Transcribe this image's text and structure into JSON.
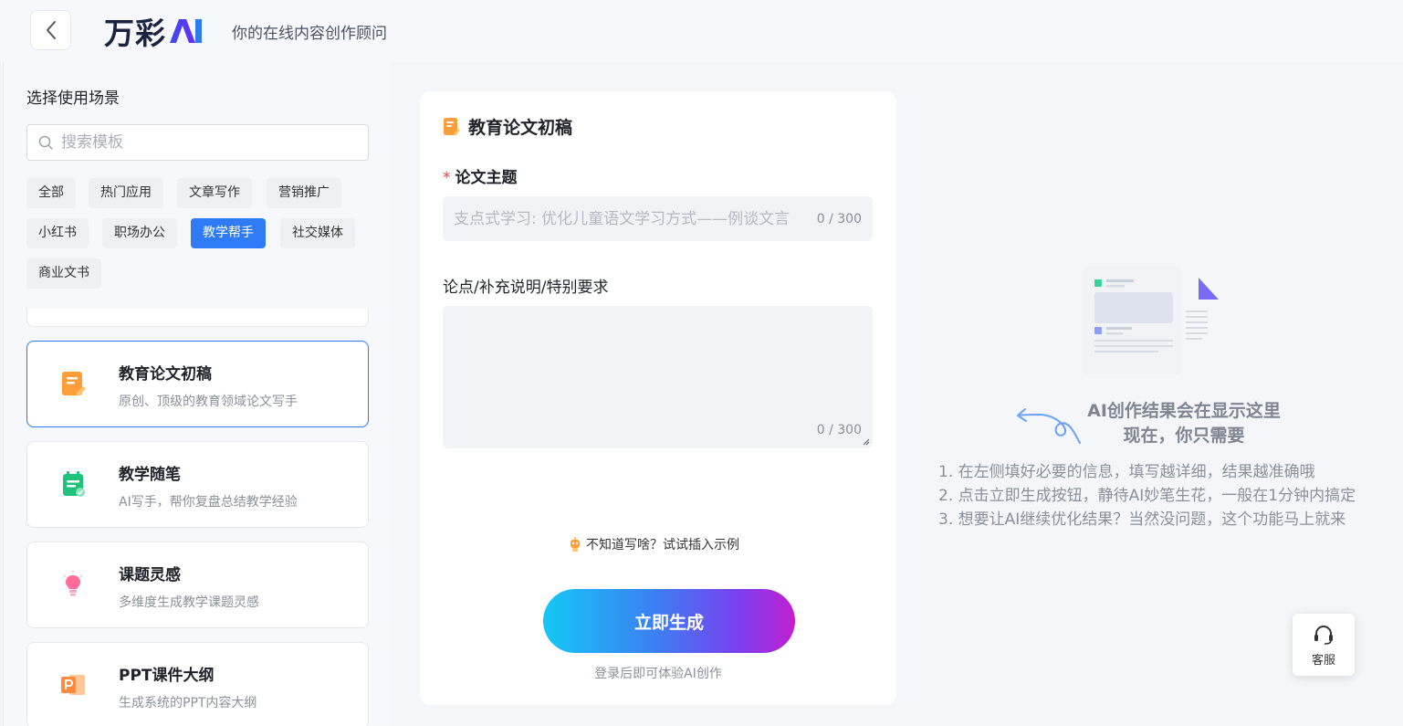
{
  "header": {
    "logo_text": "万彩",
    "slogan": "你的在线内容创作顾问"
  },
  "sidebar": {
    "title": "选择使用场景",
    "search_placeholder": "搜索模板",
    "tags": [
      "全部",
      "热门应用",
      "文章写作",
      "营销推广",
      "小红书",
      "职场办公",
      "教学帮手",
      "社交媒体",
      "商业文书"
    ],
    "active_tag": "教学帮手",
    "cards": [
      {
        "title": "教育论文初稿",
        "desc": "原创、顶级的教育领域论文写手",
        "icon": "essay-icon",
        "active": true
      },
      {
        "title": "教学随笔",
        "desc": "AI写手，帮你复盘总结教学经验",
        "icon": "notepad-icon",
        "active": false
      },
      {
        "title": "课题灵感",
        "desc": "多维度生成教学课题灵感",
        "icon": "lightbulb-icon",
        "active": false
      },
      {
        "title": "PPT课件大纲",
        "desc": "生成系统的PPT内容大纲",
        "icon": "ppt-icon",
        "active": false
      }
    ]
  },
  "form": {
    "title": "教育论文初稿",
    "topic_label": "论文主题",
    "topic_placeholder": "支点式学习: 优化儿童语文学习方式——例谈文言",
    "topic_counter": "0 / 300",
    "extra_label": "论点/补充说明/特别要求",
    "extra_counter": "0 / 300",
    "hint": "不知道写啥？试试插入示例",
    "generate_label": "立即生成",
    "login_tip": "登录后即可体验AI创作"
  },
  "result": {
    "title_line1": "AI创作结果会在显示这里",
    "title_line2": "现在，你只需要",
    "steps": [
      "1. 在左侧填好必要的信息，填写越详细，结果越准确哦",
      "2. 点击立即生成按钮，静待AI妙笔生花，一般在1分钟内搞定",
      "3. 想要让AI继续优化结果？当然没问题，这个功能马上就来"
    ]
  },
  "service": {
    "label": "客服"
  },
  "colors": {
    "accent": "#2f7bf5",
    "required": "#f0403c"
  }
}
